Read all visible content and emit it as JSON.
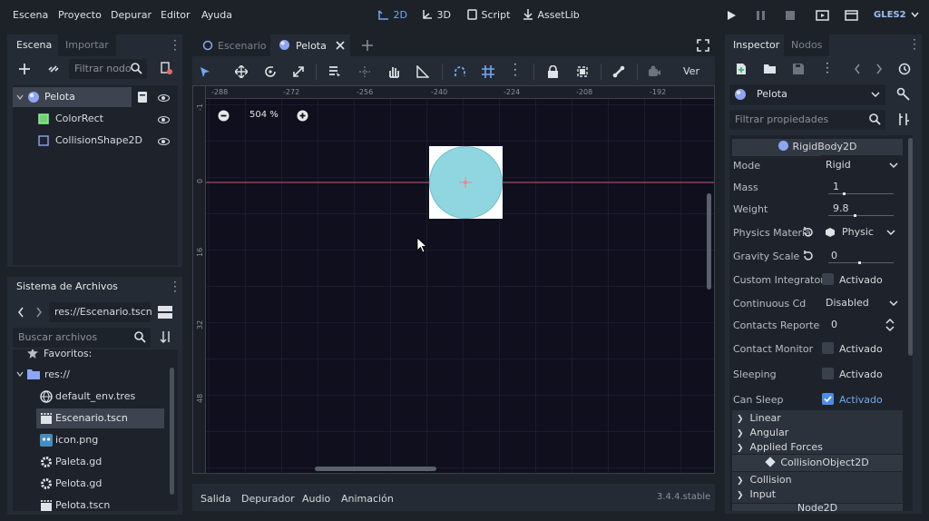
{
  "menu": [
    "Escena",
    "Proyecto",
    "Depurar",
    "Editor",
    "Ayuda"
  ],
  "workspaces": {
    "w2d": "2D",
    "w3d": "3D",
    "script": "Script",
    "assetlib": "AssetLib"
  },
  "renderer": "GLES2",
  "scene_panel": {
    "tabs": [
      "Escena",
      "Importar"
    ],
    "filter_placeholder": "Filtrar nodo",
    "nodes": [
      {
        "label": "Pelota"
      },
      {
        "label": "ColorRect"
      },
      {
        "label": "CollisionShape2D"
      }
    ]
  },
  "fs_panel": {
    "title": "Sistema de Archivos",
    "path": "res://Escenario.tscn",
    "search_placeholder": "Buscar archivos",
    "favorites": "Favoritos:",
    "root": "res://",
    "files": [
      "default_env.tres",
      "Escenario.tscn",
      "icon.png",
      "Paleta.gd",
      "Pelota.gd",
      "Pelota.tscn"
    ]
  },
  "editor": {
    "tabs": [
      "Escenario",
      "Pelota"
    ],
    "view_label": "Ver",
    "zoom": "504 %",
    "hruler": [
      "-288",
      "-272",
      "-256",
      "-240",
      "-224",
      "-208",
      "-192"
    ],
    "vruler": [
      "-1",
      "0",
      "16",
      "32",
      "48"
    ]
  },
  "bottom": {
    "tabs": [
      "Salida",
      "Depurador",
      "Audio",
      "Animación"
    ],
    "version": "3.4.4.stable"
  },
  "inspector": {
    "tabs": [
      "Inspector",
      "Nodos"
    ],
    "node": "Pelota",
    "filter_placeholder": "Filtrar propiedades",
    "class": "RigidBody2D",
    "props": [
      {
        "label": "Mode",
        "value": "Rigid"
      },
      {
        "label": "Mass",
        "value": "1"
      },
      {
        "label": "Weight",
        "value": "9.8"
      },
      {
        "label": "Physics Materia",
        "value": "Physic"
      },
      {
        "label": "Gravity Scale",
        "value": "0"
      },
      {
        "label": "Custom Integrator",
        "value": "Activado"
      },
      {
        "label": "Continuous Cd",
        "value": "Disabled"
      },
      {
        "label": "Contacts Reported",
        "value": "0"
      },
      {
        "label": "Contact Monitor",
        "value": "Activado"
      },
      {
        "label": "Sleeping",
        "value": "Activado"
      },
      {
        "label": "Can Sleep",
        "value": "Activado"
      }
    ],
    "groups": [
      "Linear",
      "Angular",
      "Applied Forces"
    ],
    "class2": "CollisionObject2D",
    "groups2": [
      "Collision",
      "Input"
    ],
    "class3": "Node2D"
  }
}
